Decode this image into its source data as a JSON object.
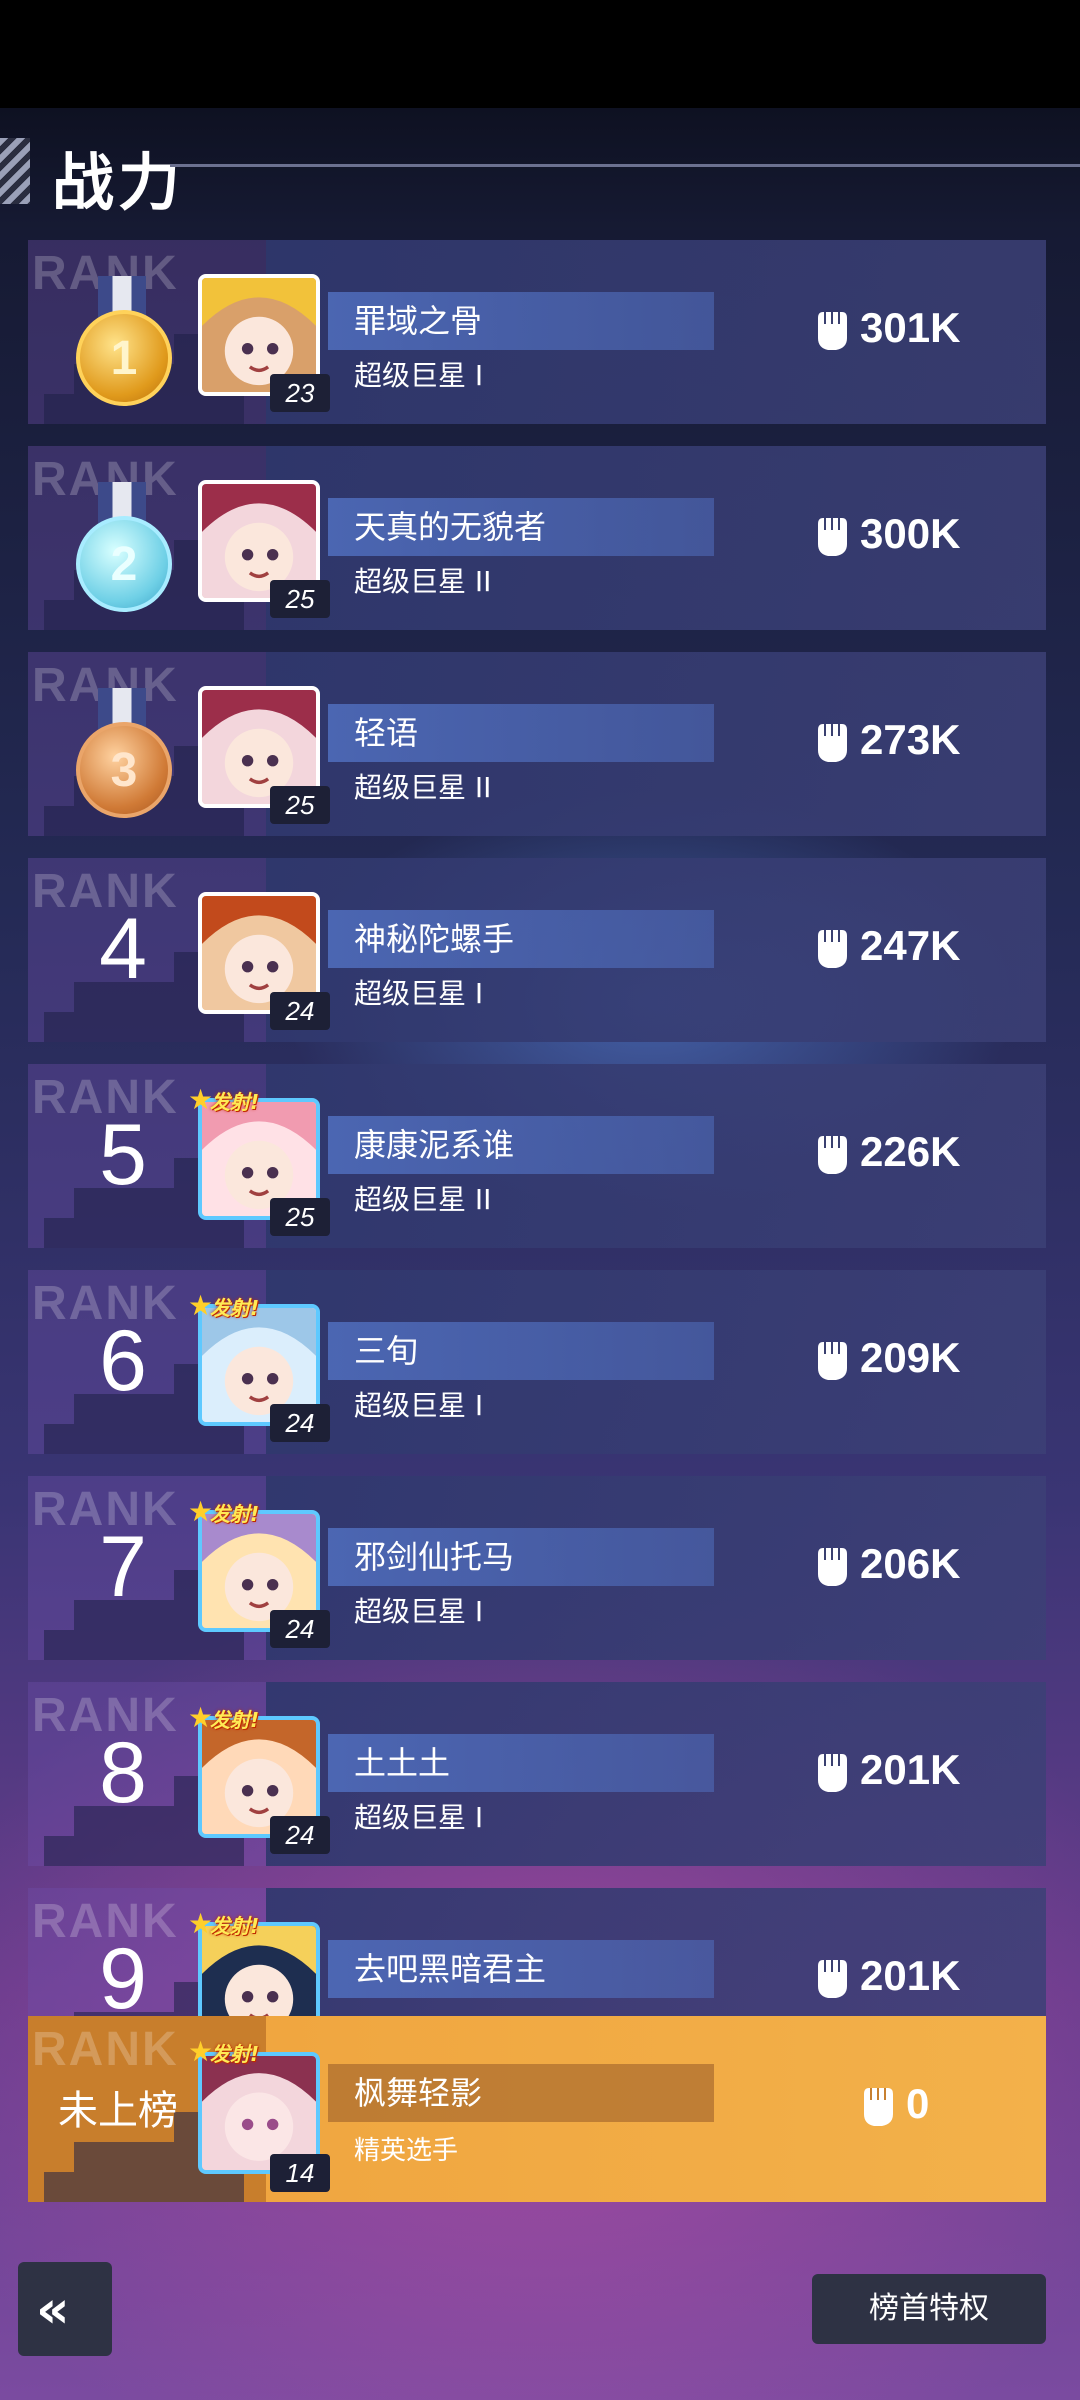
{
  "header": {
    "title": "战力"
  },
  "ranking": {
    "rank_word": "RANK",
    "entries": [
      {
        "rank": "1",
        "medal": "gold-medal-icon",
        "name": "罪域之骨",
        "tier": "超级巨星 I",
        "level": "23",
        "power": "301K",
        "badge": ""
      },
      {
        "rank": "2",
        "medal": "silver-medal-icon",
        "name": "天真的无貌者",
        "tier": "超级巨星 II",
        "level": "25",
        "power": "300K",
        "badge": ""
      },
      {
        "rank": "3",
        "medal": "bronze-medal-icon",
        "name": "轻语",
        "tier": "超级巨星 II",
        "level": "25",
        "power": "273K",
        "badge": ""
      },
      {
        "rank": "4",
        "medal": "",
        "name": "神秘陀螺手",
        "tier": "超级巨星 I",
        "level": "24",
        "power": "247K",
        "badge": ""
      },
      {
        "rank": "5",
        "medal": "",
        "name": "康康泥系谁",
        "tier": "超级巨星 II",
        "level": "25",
        "power": "226K",
        "badge": "发射!"
      },
      {
        "rank": "6",
        "medal": "",
        "name": "三旬",
        "tier": "超级巨星 I",
        "level": "24",
        "power": "209K",
        "badge": "发射!"
      },
      {
        "rank": "7",
        "medal": "",
        "name": "邪剑仙托马",
        "tier": "超级巨星 I",
        "level": "24",
        "power": "206K",
        "badge": "发射!"
      },
      {
        "rank": "8",
        "medal": "",
        "name": "土土土",
        "tier": "超级巨星 I",
        "level": "24",
        "power": "201K",
        "badge": "发射!"
      },
      {
        "rank": "9",
        "medal": "",
        "name": "去吧黑暗君主",
        "tier": "",
        "level": "",
        "power": "201K",
        "badge": "发射!"
      }
    ]
  },
  "me": {
    "rank_label": "未上榜",
    "name": "枫舞轻影",
    "tier": "精英选手",
    "level": "14",
    "power": "0",
    "badge": "发射!"
  },
  "footer": {
    "back_icon": "back-chevron-icon",
    "perk_label": "榜首特权"
  },
  "colors": {
    "me_row": "#f0a640",
    "card": "#30386e",
    "button": "#2e3244"
  }
}
